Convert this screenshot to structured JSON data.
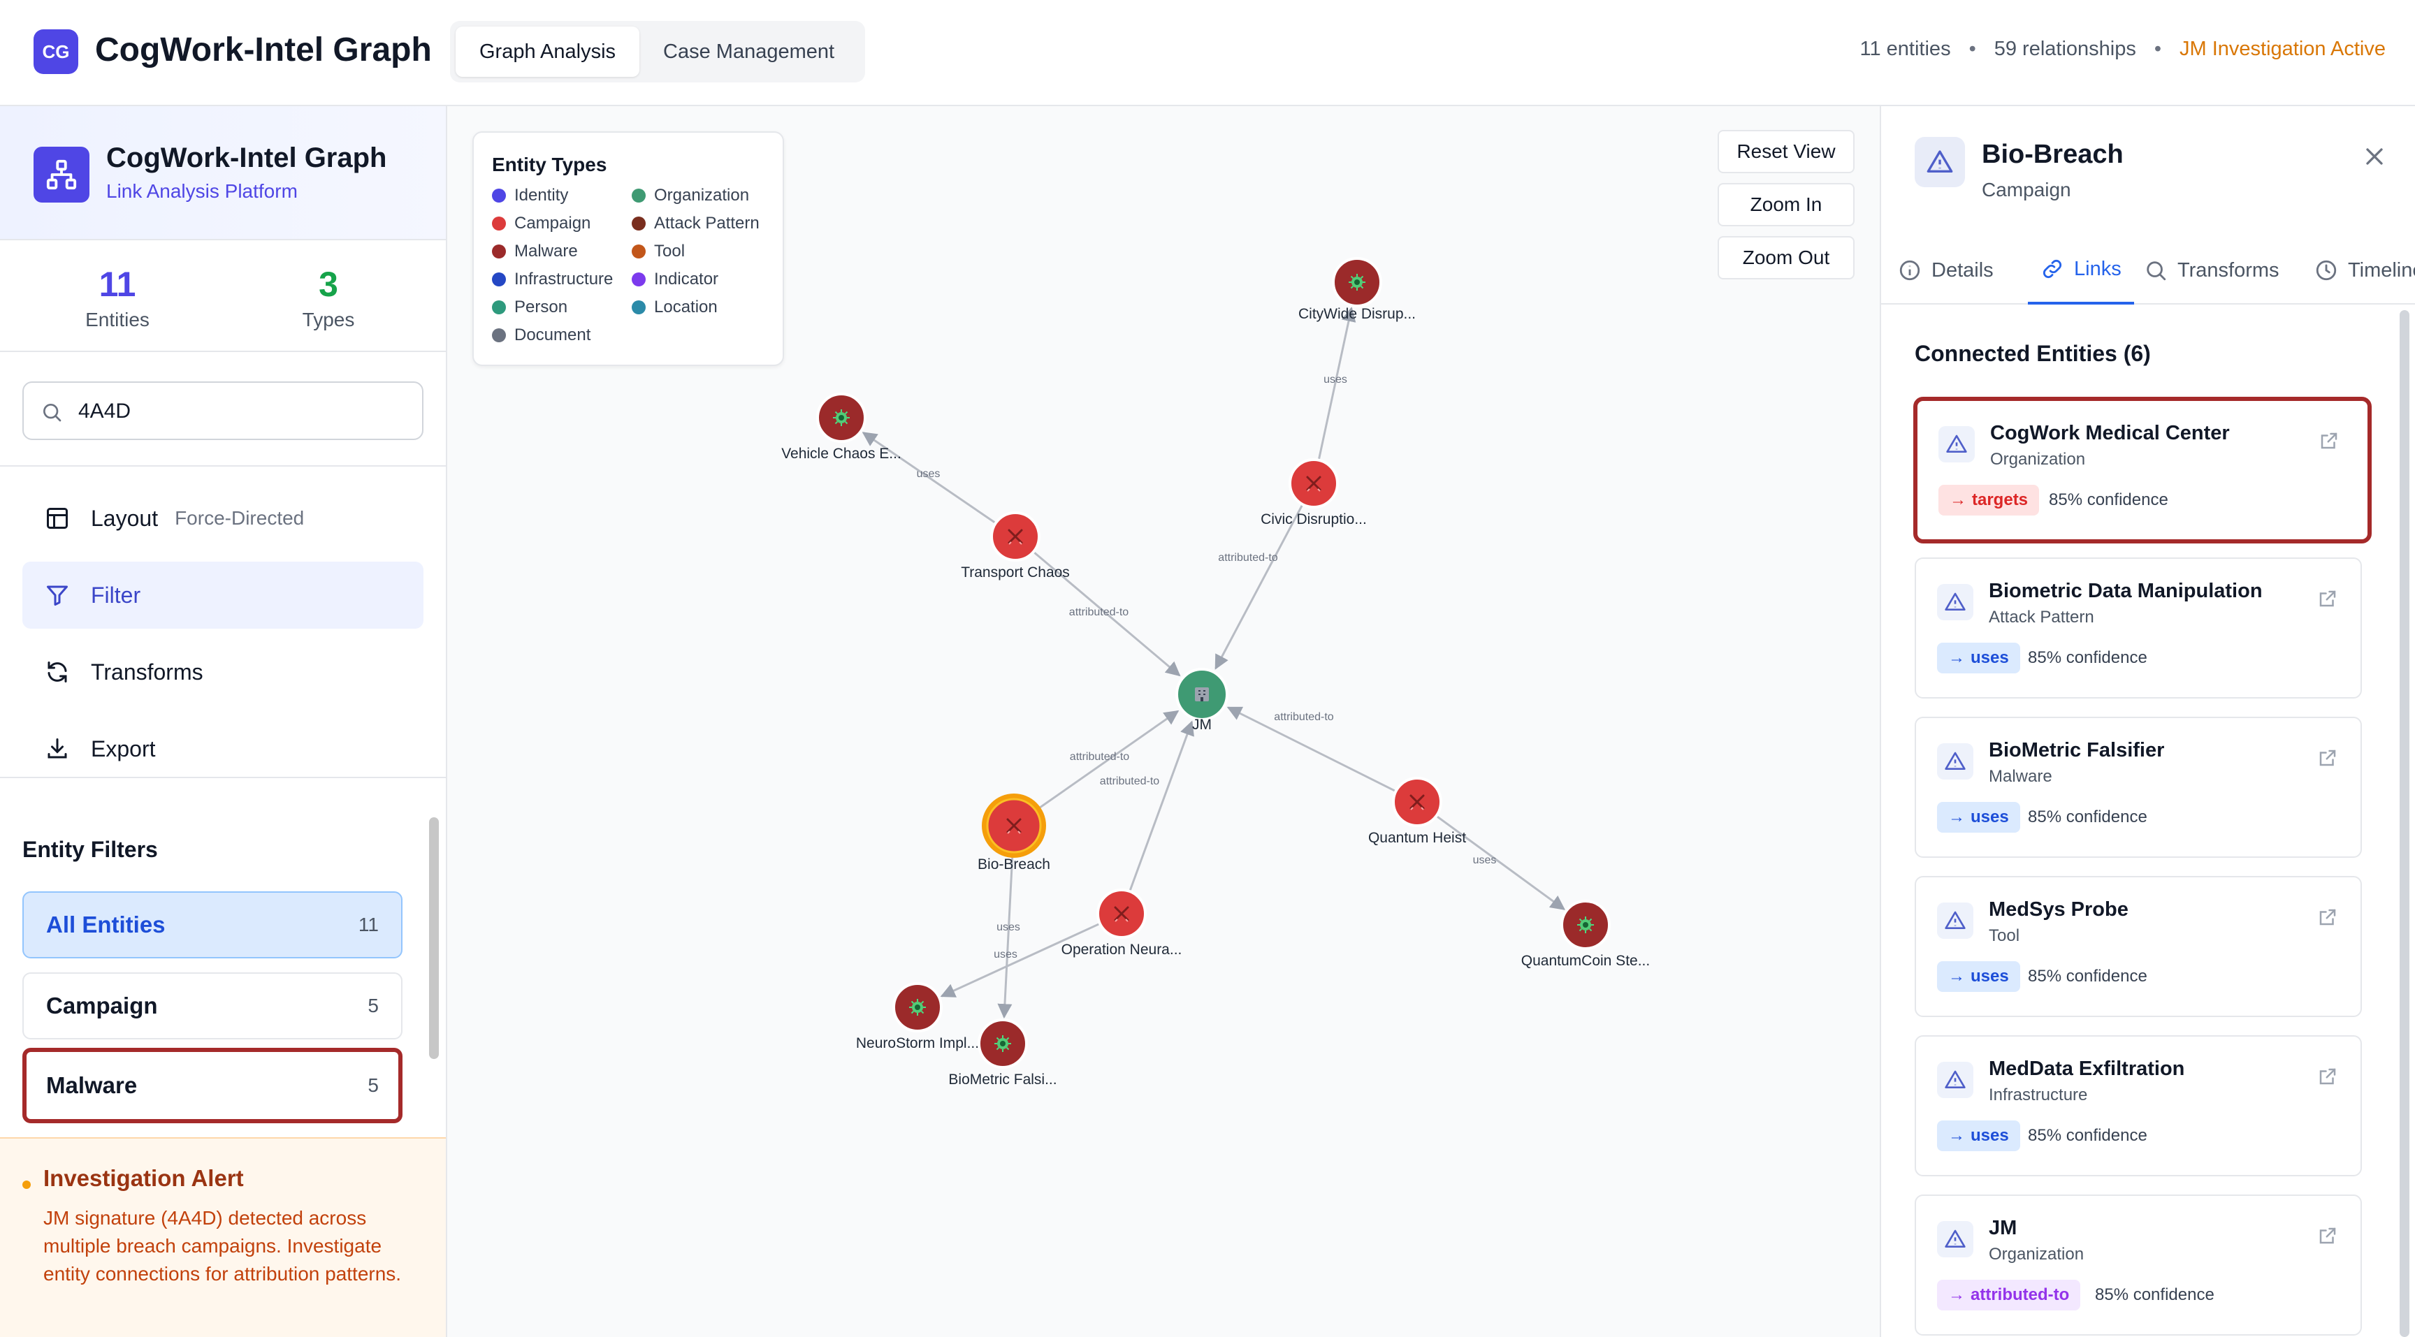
{
  "header": {
    "logo_text": "CG",
    "title": "CogWork-Intel Graph",
    "tabs": [
      {
        "label": "Graph Analysis",
        "active": true
      },
      {
        "label": "Case Management",
        "active": false
      }
    ],
    "entities_stat": "11 entities",
    "separator": "•",
    "relationships_stat": "59 relationships",
    "investigation_status": "JM Investigation Active"
  },
  "sidebar": {
    "title": "CogWork-Intel Graph",
    "subtitle": "Link Analysis Platform",
    "stats": [
      {
        "value": "11",
        "label": "Entities",
        "color": "#4f46e5"
      },
      {
        "value": "3",
        "label": "Types",
        "color": "#16a34a"
      }
    ],
    "search_value": "4A4D",
    "menu": [
      {
        "label": "Layout",
        "extra": "Force-Directed",
        "icon": "layout-icon"
      },
      {
        "label": "Filter",
        "extra": "",
        "icon": "filter-icon",
        "active": true
      },
      {
        "label": "Transforms",
        "extra": "",
        "icon": "refresh-icon"
      },
      {
        "label": "Export",
        "extra": "",
        "icon": "download-icon"
      }
    ],
    "filters_title": "Entity Filters",
    "filters": [
      {
        "label": "All Entities",
        "count": "11",
        "active": true
      },
      {
        "label": "Campaign",
        "count": "5"
      },
      {
        "label": "Malware",
        "count": "5",
        "highlight": true
      }
    ],
    "alert": {
      "title": "Investigation Alert",
      "body": "JM signature (4A4D) detected across multiple breach campaigns. Investigate entity connections for attribution patterns."
    }
  },
  "graph": {
    "legend_title": "Entity Types",
    "legend": [
      {
        "label": "Identity",
        "color": "#4f46e5"
      },
      {
        "label": "Organization",
        "color": "#3f9a73"
      },
      {
        "label": "Campaign",
        "color": "#dc3b3b"
      },
      {
        "label": "Attack Pattern",
        "color": "#7a2e1e"
      },
      {
        "label": "Malware",
        "color": "#9b2a2a"
      },
      {
        "label": "Tool",
        "color": "#c2561a"
      },
      {
        "label": "Infrastructure",
        "color": "#2447c4"
      },
      {
        "label": "Indicator",
        "color": "#7c3aed"
      },
      {
        "label": "Person",
        "color": "#2e9a7d"
      },
      {
        "label": "Location",
        "color": "#2b8aa8"
      },
      {
        "label": "Document",
        "color": "#6b7280"
      }
    ],
    "controls": {
      "reset": "Reset View",
      "zoom_in": "Zoom In",
      "zoom_out": "Zoom Out"
    },
    "nodes": [
      {
        "id": "jm",
        "label": "JM",
        "kind": "organization"
      },
      {
        "id": "citywide",
        "label": "CityWide Disrup...",
        "kind": "malware"
      },
      {
        "id": "civic",
        "label": "Civic Disruptio...",
        "kind": "campaign"
      },
      {
        "id": "vehicle",
        "label": "Vehicle Chaos E...",
        "kind": "malware"
      },
      {
        "id": "transport",
        "label": "Transport Chaos",
        "kind": "campaign"
      },
      {
        "id": "biobreach",
        "label": "Bio-Breach",
        "kind": "campaign",
        "selected": true
      },
      {
        "id": "opneura",
        "label": "Operation Neura...",
        "kind": "campaign"
      },
      {
        "id": "quantum",
        "label": "Quantum Heist",
        "kind": "campaign"
      },
      {
        "id": "qcoin",
        "label": "QuantumCoin Ste...",
        "kind": "malware"
      },
      {
        "id": "neurostorm",
        "label": "NeuroStorm Impl...",
        "kind": "malware"
      },
      {
        "id": "biofalsi",
        "label": "BioMetric Falsi...",
        "kind": "malware"
      }
    ],
    "edges": [
      {
        "from": "civic",
        "to": "citywide",
        "label": "uses"
      },
      {
        "from": "transport",
        "to": "vehicle",
        "label": "uses"
      },
      {
        "from": "civic",
        "to": "jm",
        "label": "attributed-to"
      },
      {
        "from": "transport",
        "to": "jm",
        "label": "attributed-to"
      },
      {
        "from": "biobreach",
        "to": "jm",
        "label": "attributed-to"
      },
      {
        "from": "opneura",
        "to": "jm",
        "label": "attributed-to"
      },
      {
        "from": "quantum",
        "to": "jm",
        "label": "attributed-to"
      },
      {
        "from": "quantum",
        "to": "qcoin",
        "label": "uses"
      },
      {
        "from": "biobreach",
        "to": "biofalsi",
        "label": "uses"
      },
      {
        "from": "opneura",
        "to": "neurostorm",
        "label": "uses"
      }
    ]
  },
  "panel": {
    "title": "Bio-Breach",
    "subtitle": "Campaign",
    "tabs": [
      {
        "label": "Details",
        "icon": "info-icon"
      },
      {
        "label": "Links",
        "icon": "link-icon",
        "active": true
      },
      {
        "label": "Transforms",
        "icon": "search-icon"
      },
      {
        "label": "Timeline",
        "icon": "clock-icon"
      }
    ],
    "connected_title": "Connected Entities (6)",
    "links": [
      {
        "name": "CogWork Medical Center",
        "type": "Organization",
        "relation": "targets",
        "confidence": "85% confidence",
        "highlight": true
      },
      {
        "name": "Biometric Data Manipulation",
        "type": "Attack Pattern",
        "relation": "uses",
        "confidence": "85% confidence"
      },
      {
        "name": "BioMetric Falsifier",
        "type": "Malware",
        "relation": "uses",
        "confidence": "85% confidence"
      },
      {
        "name": "MedSys Probe",
        "type": "Tool",
        "relation": "uses",
        "confidence": "85% confidence"
      },
      {
        "name": "MedData Exfiltration",
        "type": "Infrastructure",
        "relation": "uses",
        "confidence": "85% confidence"
      },
      {
        "name": "JM",
        "type": "Organization",
        "relation": "attributed-to",
        "confidence": "85% confidence"
      }
    ]
  }
}
